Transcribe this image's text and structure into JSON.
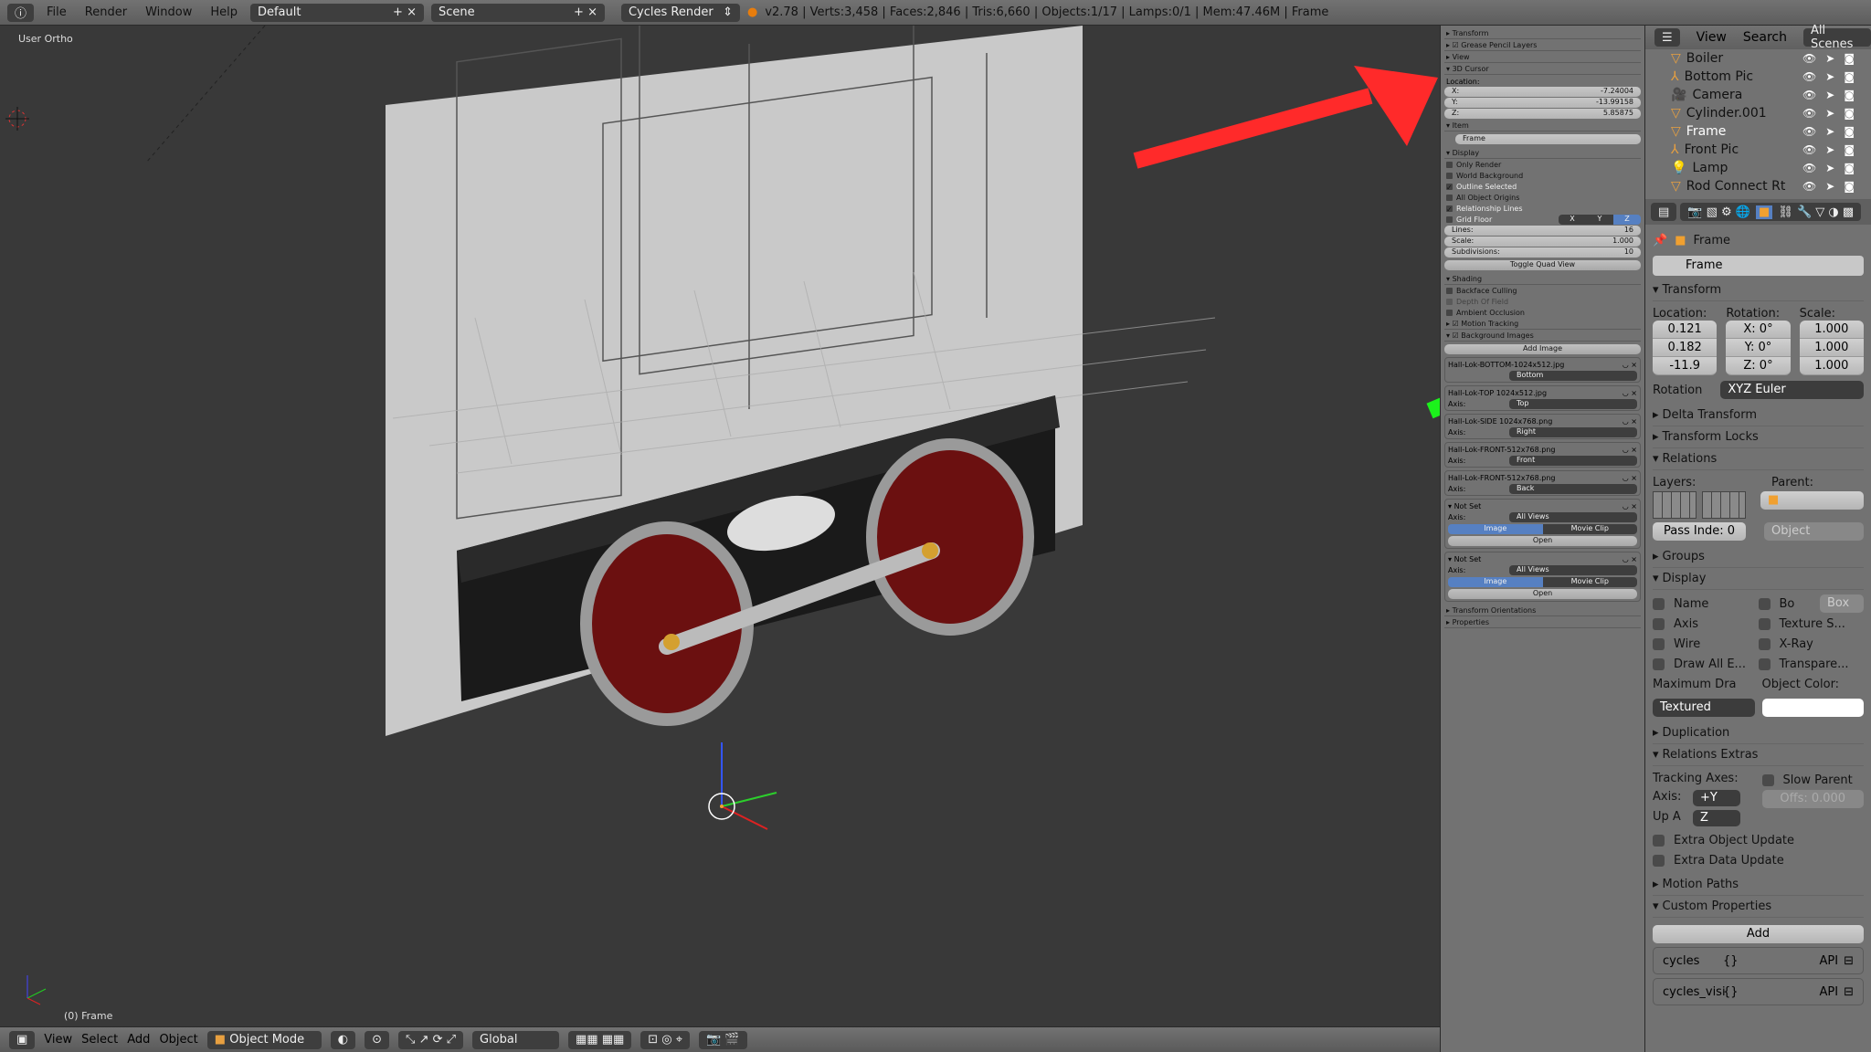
{
  "topbar": {
    "menus": [
      "File",
      "Render",
      "Window",
      "Help"
    ],
    "layout": "Default",
    "scene": "Scene",
    "engine": "Cycles Render",
    "stats": "v2.78 | Verts:3,458 | Faces:2,846 | Tris:6,660 | Objects:1/17 | Lamps:0/1 | Mem:47.46M | Frame"
  },
  "viewport": {
    "view_label": "User Ortho",
    "object_label": "(0) Frame"
  },
  "bottombar": {
    "menus": [
      "View",
      "Select",
      "Add",
      "Object"
    ],
    "mode": "Object Mode",
    "orientation": "Global"
  },
  "npanel": {
    "sections_top": [
      "Transform",
      "Grease Pencil Layers",
      "View"
    ],
    "cursor": {
      "title": "3D Cursor",
      "location_label": "Location:",
      "x_label": "X:",
      "x": "-7.24004",
      "y_label": "Y:",
      "y": "-13.99158",
      "z_label": "Z:",
      "z": "5.85875"
    },
    "item": {
      "title": "Item",
      "name": "Frame"
    },
    "display": {
      "title": "Display",
      "checks": [
        "Only Render",
        "World Background",
        "Outline Selected",
        "All Object Origins",
        "Relationship Lines"
      ],
      "grid_floor": "Grid Floor",
      "axes": [
        "X",
        "Y",
        "Z"
      ],
      "lines_label": "Lines:",
      "lines": "16",
      "scale_label": "Scale:",
      "scale": "1.000",
      "subdiv_label": "Subdivisions:",
      "subdiv": "10",
      "quad": "Toggle Quad View"
    },
    "shading": {
      "title": "Shading",
      "checks": [
        "Backface Culling",
        "Depth Of Field",
        "Ambient Occlusion"
      ]
    },
    "motion_tracking": "Motion Tracking",
    "bg_images": {
      "title": "Background Images",
      "add": "Add Image",
      "axis_label": "Axis:",
      "items": [
        {
          "name": "Hall-Lok-BOTTOM-1024x512.jpg",
          "axis": "Bottom"
        },
        {
          "name": "Hall-Lok-TOP 1024x512.jpg",
          "axis": "Top"
        },
        {
          "name": "Hall-Lok-SIDE 1024x768.png",
          "axis": "Right"
        },
        {
          "name": "Hall-Lok-FRONT-512x768.png",
          "axis": "Front"
        },
        {
          "name": "Hall-Lok-FRONT-512x768.png",
          "axis": "Back"
        }
      ],
      "unset": [
        {
          "name": "Not Set",
          "axis": "All Views"
        },
        {
          "name": "Not Set",
          "axis": "All Views"
        }
      ],
      "image": "Image",
      "movie": "Movie Clip",
      "open": "Open"
    },
    "sections_bottom": [
      "Transform Orientations",
      "Properties"
    ]
  },
  "outliner": {
    "menu": [
      "View",
      "Search"
    ],
    "filter": "All Scenes",
    "items": [
      {
        "name": "Boiler",
        "icon": "mesh-icon"
      },
      {
        "name": "Bottom Pic",
        "icon": "empty-icon"
      },
      {
        "name": "Camera",
        "icon": "camera-icon"
      },
      {
        "name": "Cylinder.001",
        "icon": "mesh-icon"
      },
      {
        "name": "Frame",
        "icon": "mesh-icon",
        "selected": true
      },
      {
        "name": "Front Pic",
        "icon": "empty-icon"
      },
      {
        "name": "Lamp",
        "icon": "lamp-icon"
      },
      {
        "name": "Rod Connect Rt",
        "icon": "mesh-icon"
      }
    ]
  },
  "properties": {
    "breadcrumb": "Frame",
    "object_name": "Frame",
    "transform": {
      "title": "Transform",
      "loc_label": "Location:",
      "rot_label": "Rotation:",
      "scale_label": "Scale:",
      "location": [
        "0.121",
        "0.182",
        "-11.9"
      ],
      "rotation": [
        "X:  0°",
        "Y:  0°",
        "Z:  0°"
      ],
      "scale": [
        "1.000",
        "1.000",
        "1.000"
      ],
      "mode_label": "Rotation",
      "mode": "XYZ Euler"
    },
    "delta": "Delta Transform",
    "locks": "Transform Locks",
    "relations": {
      "title": "Relations",
      "layers": "Layers:",
      "parent": "Parent:",
      "parent_type": "Object",
      "pass": "Pass Inde: 0"
    },
    "groups": "Groups",
    "display": {
      "title": "Display",
      "left": [
        "Name",
        "Axis",
        "Wire",
        "Draw All E..."
      ],
      "right": [
        "Bo",
        "Texture S...",
        "X-Ray",
        "Transpare..."
      ],
      "bounds": "Box",
      "max_draw_label": "Maximum Dra",
      "max_draw": "Textured",
      "color_label": "Object Color:",
      "color": "#ffffff"
    },
    "duplication": "Duplication",
    "rel_extras": {
      "title": "Relations Extras",
      "tracking": "Tracking Axes:",
      "slow_parent": "Slow Parent",
      "axis_label": "Axis:",
      "axis": "+Y",
      "up_label": "Up A",
      "up": "Z",
      "offs": "Offs: 0.000",
      "extra_obj": "Extra Object Update",
      "extra_data": "Extra Data Update"
    },
    "motion_paths": "Motion Paths",
    "custom": {
      "title": "Custom Properties",
      "add": "Add",
      "rows": [
        {
          "name": "cycles",
          "val": "{}",
          "api": "API"
        },
        {
          "name": "cycles_visi",
          "val": "{}",
          "api": "API"
        }
      ]
    }
  },
  "colors": {
    "annotation_red": "#ff2a2a",
    "annotation_green": "#1cf21c",
    "wheel": "#7a1010",
    "selected": "#f0a030"
  }
}
